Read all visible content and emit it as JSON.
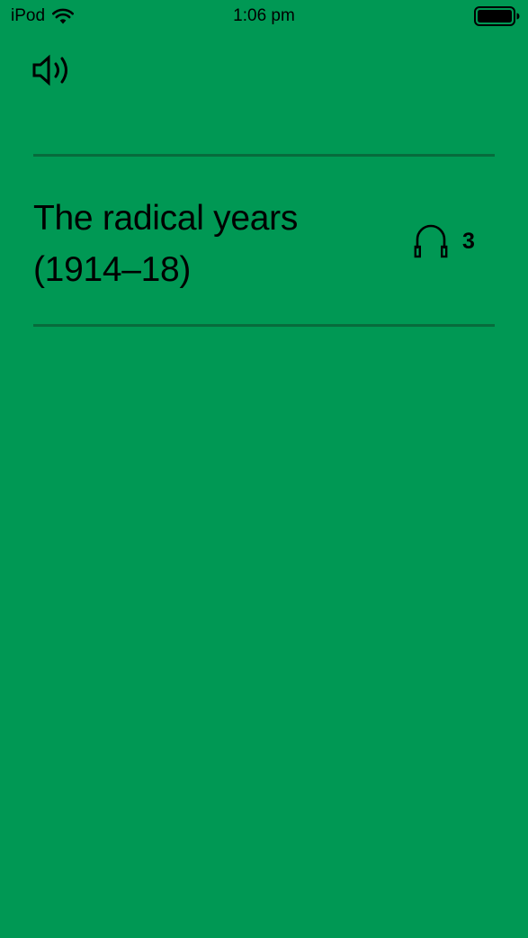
{
  "status_bar": {
    "carrier": "iPod",
    "time": "1:06 pm"
  },
  "header": {
    "audio_icon": "speaker-icon"
  },
  "tour_list": [
    {
      "title": "The radical years (1914–18)",
      "icon": "headphones-icon",
      "count": "3"
    }
  ],
  "colors": {
    "background": "#009854",
    "divider": "#076b3c",
    "text": "#000000"
  }
}
